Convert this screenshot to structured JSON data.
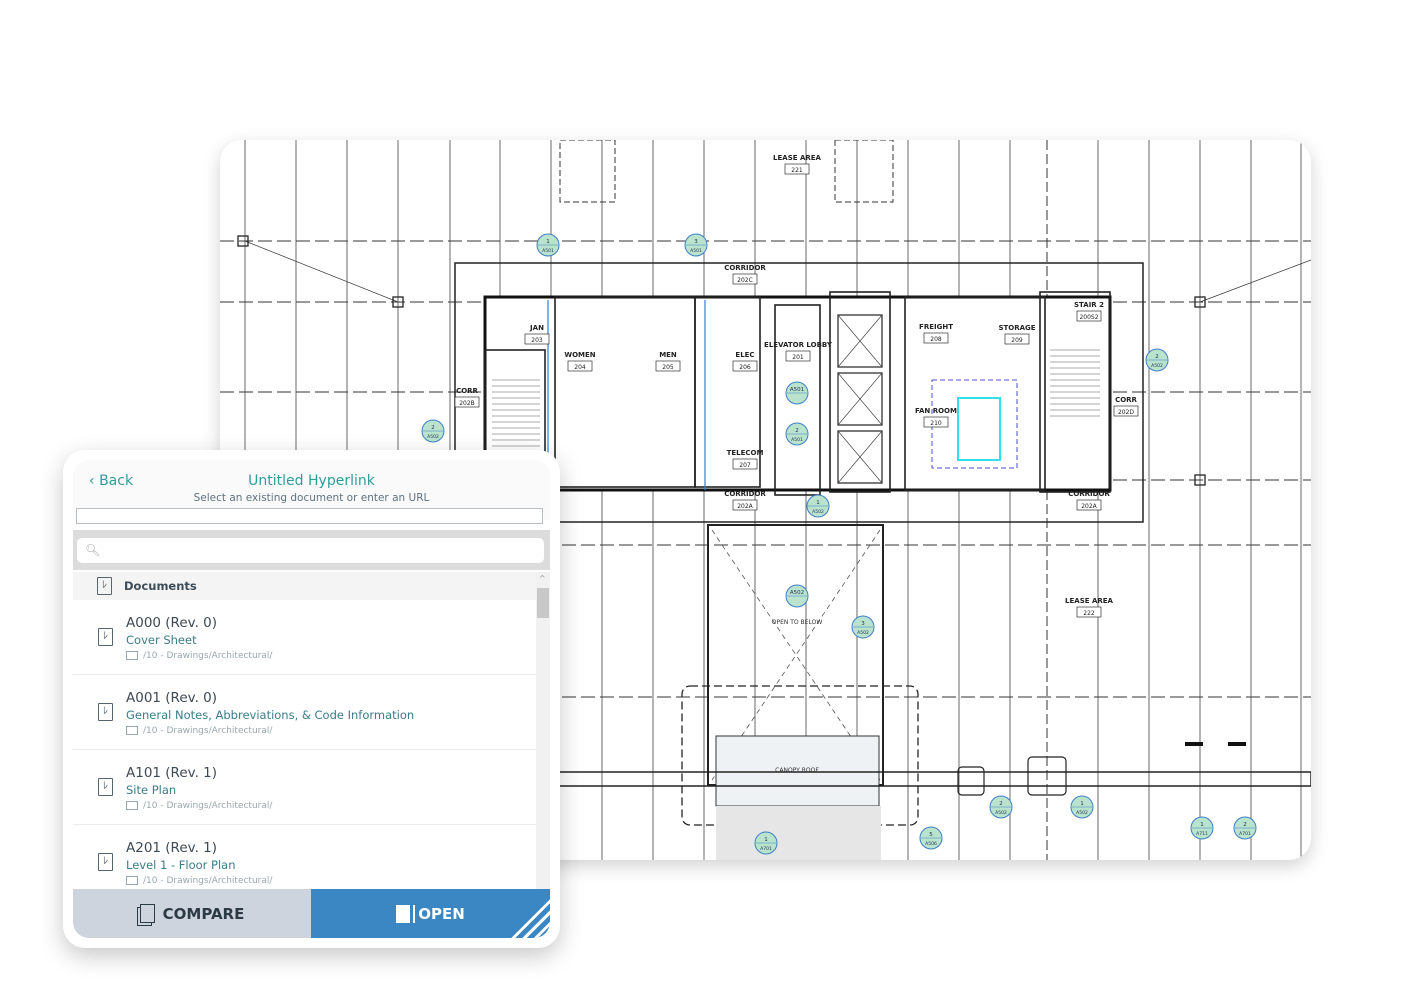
{
  "floor_plan": {
    "rooms": [
      {
        "name": "LEASE AREA",
        "number": "221"
      },
      {
        "name": "CORRIDOR",
        "number": "202C"
      },
      {
        "name": "JAN",
        "number": "203"
      },
      {
        "name": "WOMEN",
        "number": "204"
      },
      {
        "name": "MEN",
        "number": "205"
      },
      {
        "name": "ELEC",
        "number": "206"
      },
      {
        "name": "TELECOM",
        "number": "207"
      },
      {
        "name": "ELEVATOR LOBBY",
        "number": "201"
      },
      {
        "name": "FREIGHT",
        "number": "208"
      },
      {
        "name": "STORAGE",
        "number": "209"
      },
      {
        "name": "FAN ROOM",
        "number": "210"
      },
      {
        "name": "STAIR 2",
        "number": "200S2"
      },
      {
        "name": "CORR",
        "number": "202B"
      },
      {
        "name": "CORR",
        "number": "202D"
      },
      {
        "name": "CORRIDOR",
        "number": "202A"
      },
      {
        "name": "CORRIDOR",
        "number": "202A"
      },
      {
        "name": "LEASE AREA",
        "number": "222"
      }
    ],
    "notes": [
      "OPEN TO BELOW",
      "CANOPY ROOF"
    ],
    "callouts": [
      {
        "num": "1",
        "sheet": "A501"
      },
      {
        "num": "3",
        "sheet": "A501"
      },
      {
        "num": "2",
        "sheet": "A502"
      },
      {
        "num": "2",
        "sheet": "A502"
      },
      {
        "num": "A501",
        "sheet": ""
      },
      {
        "num": "2",
        "sheet": "A501"
      },
      {
        "num": "1",
        "sheet": "A502"
      },
      {
        "num": "A502",
        "sheet": ""
      },
      {
        "num": "3",
        "sheet": "A502"
      },
      {
        "num": "2",
        "sheet": "A502"
      },
      {
        "num": "1",
        "sheet": "A502"
      },
      {
        "num": "5",
        "sheet": "A506"
      },
      {
        "num": "1",
        "sheet": "A701"
      },
      {
        "num": "1",
        "sheet": "A711"
      },
      {
        "num": "2",
        "sheet": "A701"
      }
    ],
    "accent_color": "#b9e3cc"
  },
  "panel": {
    "back_label": "Back",
    "title": "Untitled Hyperlink",
    "subtitle": "Select an existing document or enter an URL",
    "url_value": "",
    "search_placeholder": "",
    "section_label": "Documents",
    "documents": [
      {
        "name": "A000 (Rev. 0)",
        "description": "Cover Sheet",
        "path": "/10 - Drawings/Architectural/"
      },
      {
        "name": "A001 (Rev. 0)",
        "description": "General Notes, Abbreviations, & Code Information",
        "path": "/10 - Drawings/Architectural/"
      },
      {
        "name": "A101 (Rev. 1)",
        "description": "Site Plan",
        "path": "/10 - Drawings/Architectural/"
      },
      {
        "name": "A201 (Rev. 1)",
        "description": "Level 1 - Floor Plan",
        "path": "/10 - Drawings/Architectural/"
      }
    ],
    "compare_label": "COMPARE",
    "open_label": "OPEN",
    "colors": {
      "accent": "#2f9c9a",
      "open_button": "#3b87c3",
      "compare_button": "#cdd4de"
    }
  }
}
